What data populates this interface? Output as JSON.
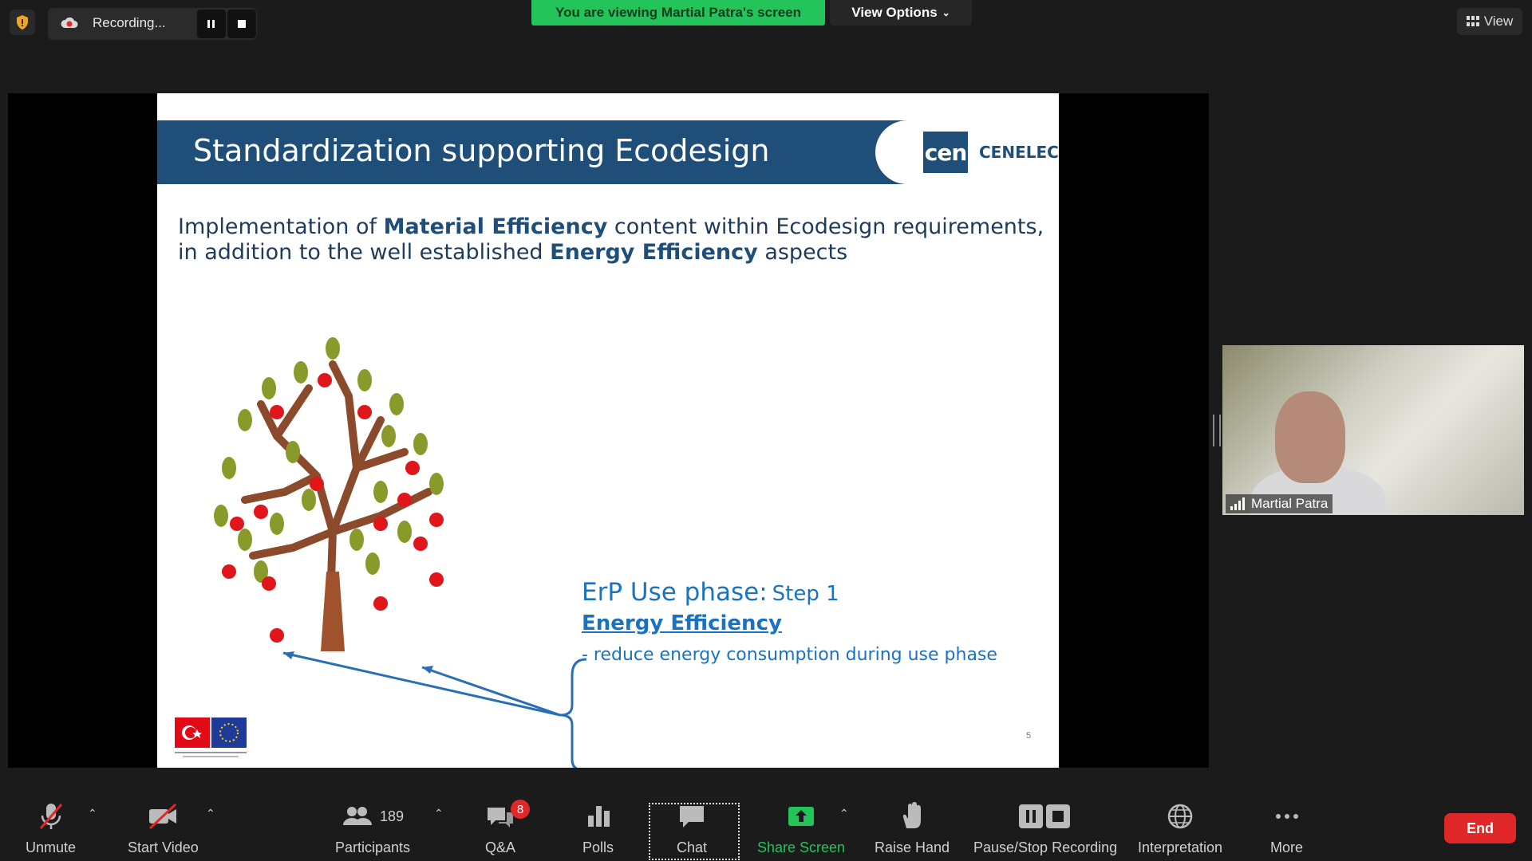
{
  "top_bar": {
    "recording_label": "Recording...",
    "viewing_banner": "You are viewing Martial Patra's screen",
    "view_options_label": "View Options",
    "view_label": "View"
  },
  "slide": {
    "title": "Standardization supporting Ecodesign",
    "logo_cen": "cen",
    "logo_cenelec": "CENELEC",
    "intro_part1": "Implementation of ",
    "intro_bold1": "Material Efficiency",
    "intro_part2": " content within Ecodesign requirements, in addition to the well established ",
    "intro_bold2": "Energy Efficiency",
    "intro_part3": " aspects",
    "erp_title": "ErP Use phase:",
    "erp_step": "Step 1",
    "erp_energy": "Energy Efficiency",
    "erp_bullet": "-   reduce energy consumption during use phase",
    "page_number": "5"
  },
  "participant": {
    "name": "Martial Patra"
  },
  "toolbar": {
    "unmute": "Unmute",
    "start_video": "Start Video",
    "participants_count": "189",
    "participants": "Participants",
    "qa": "Q&A",
    "qa_badge": "8",
    "polls": "Polls",
    "chat": "Chat",
    "share_screen": "Share Screen",
    "raise_hand": "Raise Hand",
    "pause_stop_recording": "Pause/Stop Recording",
    "interpretation": "Interpretation",
    "more": "More",
    "end": "End"
  },
  "colors": {
    "banner_green": "#23c55a",
    "end_red": "#e02828",
    "slide_blue": "#1f4e79",
    "erp_blue": "#1a73c0",
    "share_green": "#23c55a"
  }
}
